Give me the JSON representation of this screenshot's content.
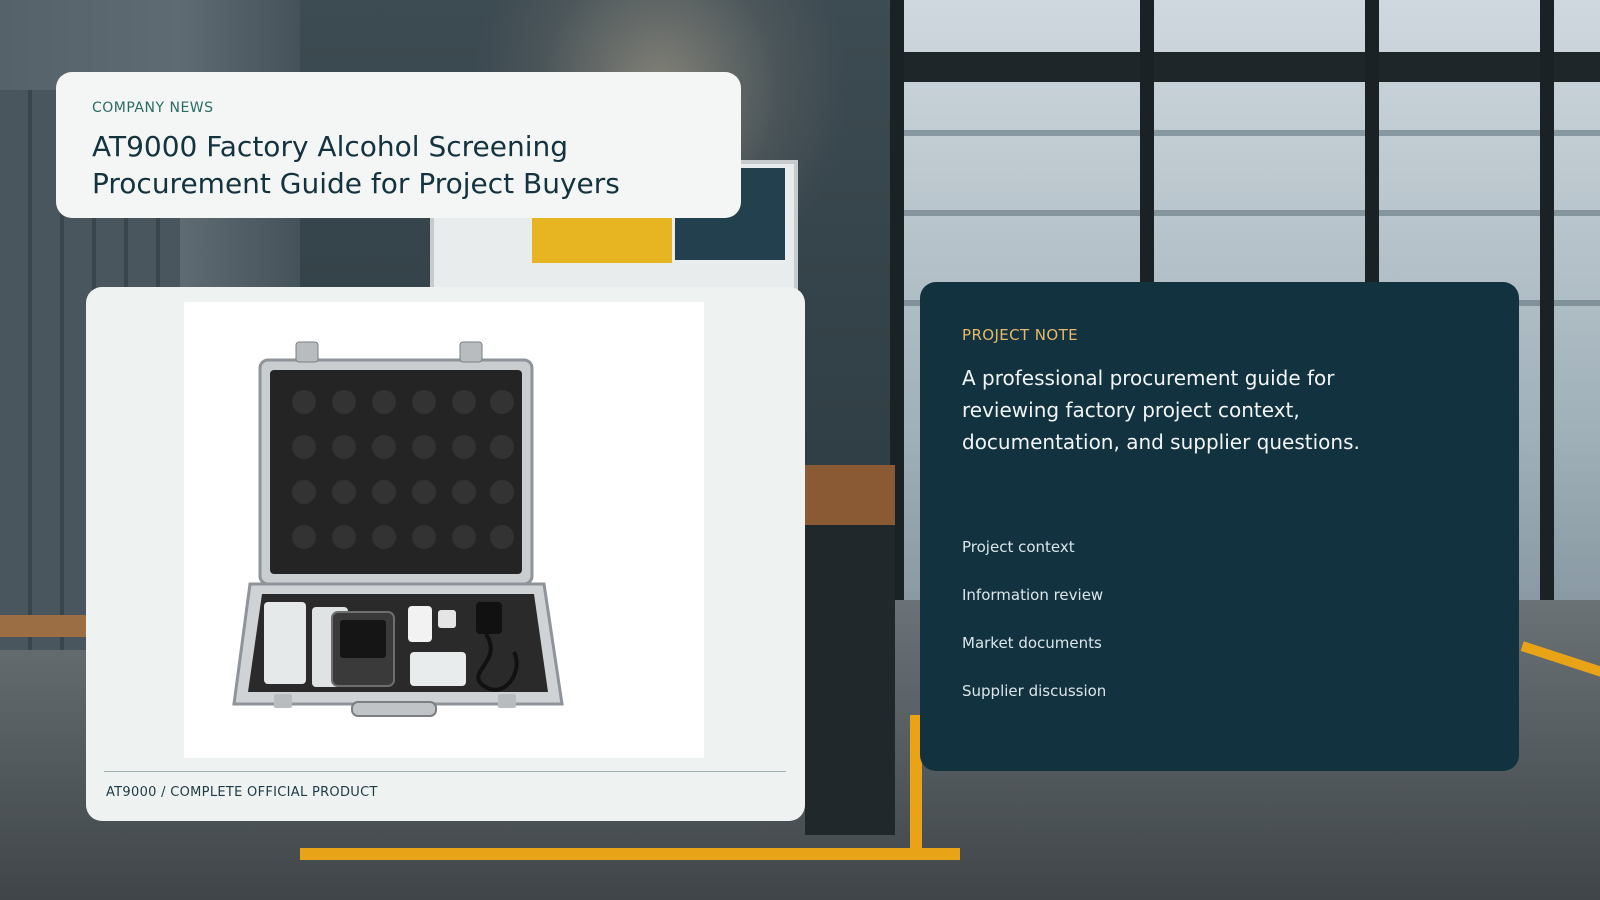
{
  "header": {
    "kicker": "COMPANY NEWS",
    "title": "AT9000 Factory Alcohol Screening Procurement Guide for Project Buyers"
  },
  "product": {
    "image_description_icon": "breathalyzer-kit-case-icon",
    "caption": "AT9000 / COMPLETE OFFICIAL PRODUCT"
  },
  "note": {
    "kicker": "PROJECT NOTE",
    "body": "A professional procurement guide for reviewing factory project context, documentation, and supplier questions.",
    "items": [
      "Project context",
      "Information review",
      "Market documents",
      "Supplier discussion"
    ]
  },
  "colors": {
    "note_background": "#12323f",
    "note_accent": "#e7b96a",
    "header_kicker": "#2b6b63",
    "floor_line": "#e8a317"
  }
}
